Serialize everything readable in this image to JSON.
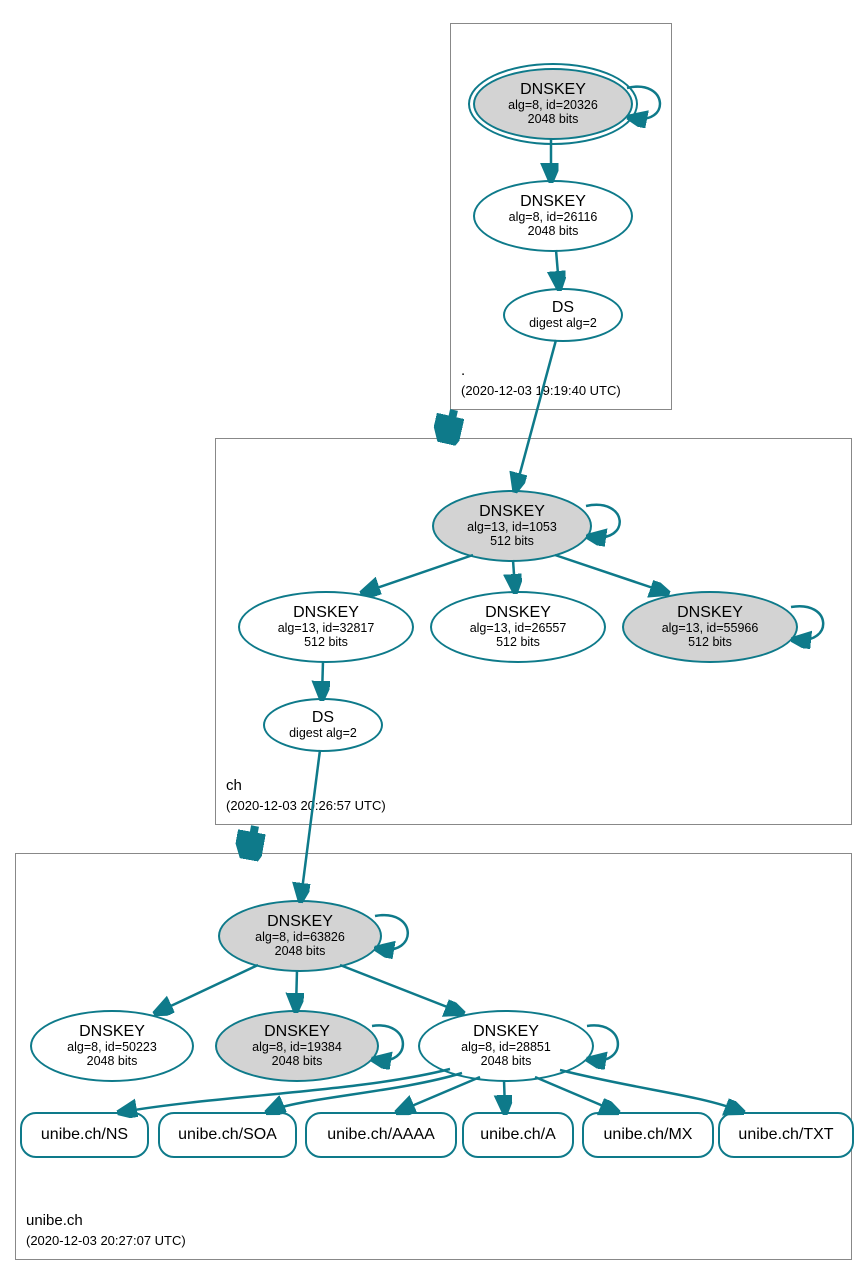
{
  "zones": {
    "root": {
      "name": ".",
      "timestamp": "(2020-12-03 19:19:40 UTC)"
    },
    "ch": {
      "name": "ch",
      "timestamp": "(2020-12-03 20:26:57 UTC)"
    },
    "unibe": {
      "name": "unibe.ch",
      "timestamp": "(2020-12-03 20:27:07 UTC)"
    }
  },
  "nodes": {
    "root_ksk": {
      "title": "DNSKEY",
      "line2": "alg=8, id=20326",
      "line3": "2048 bits"
    },
    "root_zsk": {
      "title": "DNSKEY",
      "line2": "alg=8, id=26116",
      "line3": "2048 bits"
    },
    "root_ds": {
      "title": "DS",
      "line2": "digest alg=2"
    },
    "ch_ksk": {
      "title": "DNSKEY",
      "line2": "alg=13, id=1053",
      "line3": "512 bits"
    },
    "ch_z1": {
      "title": "DNSKEY",
      "line2": "alg=13, id=32817",
      "line3": "512 bits"
    },
    "ch_z2": {
      "title": "DNSKEY",
      "line2": "alg=13, id=26557",
      "line3": "512 bits"
    },
    "ch_z3": {
      "title": "DNSKEY",
      "line2": "alg=13, id=55966",
      "line3": "512 bits"
    },
    "ch_ds": {
      "title": "DS",
      "line2": "digest alg=2"
    },
    "ub_ksk": {
      "title": "DNSKEY",
      "line2": "alg=8, id=63826",
      "line3": "2048 bits"
    },
    "ub_z1": {
      "title": "DNSKEY",
      "line2": "alg=8, id=50223",
      "line3": "2048 bits"
    },
    "ub_z2": {
      "title": "DNSKEY",
      "line2": "alg=8, id=19384",
      "line3": "2048 bits"
    },
    "ub_z3": {
      "title": "DNSKEY",
      "line2": "alg=8, id=28851",
      "line3": "2048 bits"
    }
  },
  "rrsets": {
    "ns": "unibe.ch/NS",
    "soa": "unibe.ch/SOA",
    "aaaa": "unibe.ch/AAAA",
    "a": "unibe.ch/A",
    "mx": "unibe.ch/MX",
    "txt": "unibe.ch/TXT"
  }
}
